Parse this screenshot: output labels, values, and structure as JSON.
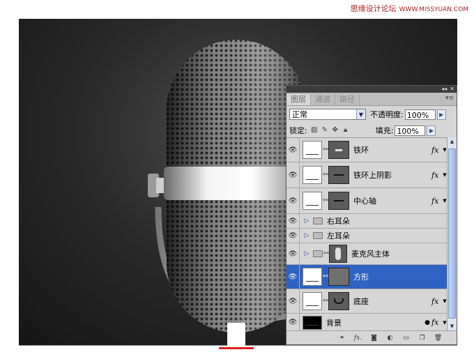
{
  "watermark": {
    "text": "思缘设计论坛",
    "url": "WWW.MISSYUAN.COM"
  },
  "panel": {
    "tabs": [
      "图层",
      "通道",
      "路径"
    ],
    "blend_mode": "正常",
    "opacity_label": "不透明度:",
    "opacity_value": "100%",
    "lock_label": "锁定:",
    "fill_label": "填充:",
    "fill_value": "100%",
    "layers": [
      {
        "name": "铁环",
        "has_fx": true,
        "selected": false
      },
      {
        "name": "铁环上阴影",
        "has_fx": true,
        "selected": false
      },
      {
        "name": "中心轴",
        "has_fx": true,
        "selected": false
      },
      {
        "name": "右耳朵",
        "group": true
      },
      {
        "name": "左耳朵",
        "group": true
      },
      {
        "name": "麦克风主体",
        "group": true
      },
      {
        "name": "方形",
        "has_fx": false,
        "selected": true
      },
      {
        "name": "底座",
        "has_fx": true,
        "selected": false
      },
      {
        "name": "背景",
        "has_fx": true,
        "selected": false
      }
    ]
  },
  "icons": [
    "eye-icon",
    "chain-icon",
    "folder-icon",
    "fx-icon",
    "lock-icon",
    "move-icon",
    "brush-icon",
    "trash-icon",
    "new-layer-icon",
    "mask-icon",
    "adjustment-icon"
  ],
  "colors": {
    "selection": "#2f63c2",
    "canvas": "#1a1a1a",
    "marker": "#e02020"
  }
}
